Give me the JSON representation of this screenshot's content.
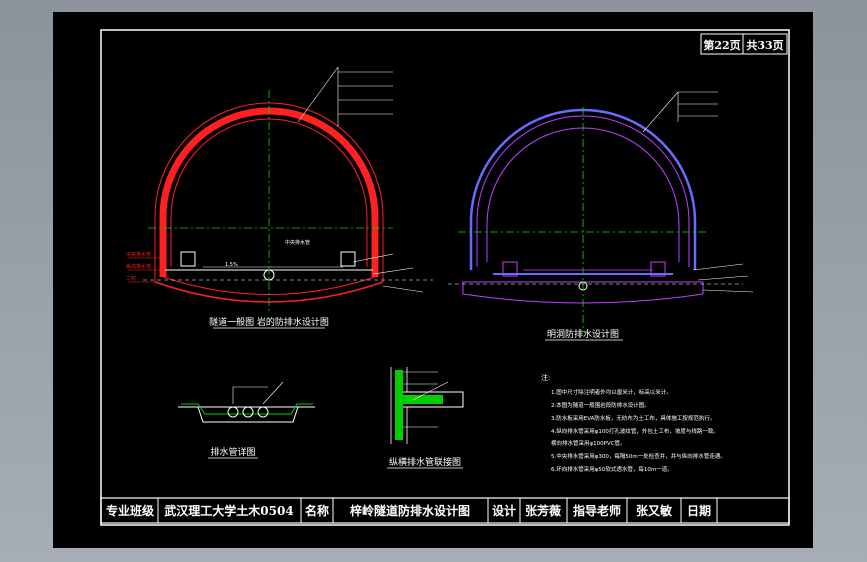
{
  "page_info": {
    "current": "第22页",
    "total": "共33页"
  },
  "title_block": {
    "major_label": "专业班级",
    "major_value": "武汉理工大学土木0504",
    "name_label": "名称",
    "name_value": "梓岭隧道防排水设计图",
    "design_label": "设计",
    "design_value": "张芳薇",
    "advisor_label": "指导老师",
    "advisor_value": "张又敏",
    "date_label": "日期"
  },
  "drawings": {
    "left_tunnel_title": "隧道一般图  岩的防排水设计图",
    "right_tunnel_title": "明洞防排水设计图",
    "drain_detail_title": "排水管详图",
    "longitudinal_title": "纵横排水管联接图"
  },
  "annotations": {
    "left_side_1": "中央排水管",
    "left_side_2": "纵向排水管",
    "left_side_3": "二衬",
    "center_text": "中央排水管",
    "left_slope": "1.5%",
    "notes_title": "注:"
  },
  "notes": [
    "1.图中尺寸除注明者外均以厘米计，标高以米计。",
    "2.本图为隧道一般围岩段防排水设计图。",
    "3.防水板采用EVA防水板，无纺布为土工布，具体施工按规范执行。",
    "4.纵向排水管采用φ100打孔波纹管，外包土工布，坡度与线路一致。",
    "  横向排水管采用φ100PVC管。",
    "5.中央排水管采用φ300，每隔50m一处检查井，并与纵向排水管连通。",
    "6.环向排水管采用φ50软式透水管，每10m一道。"
  ],
  "colors": {
    "background": "#000000",
    "frame": "#ffffff",
    "left_lining": "#ff2020",
    "right_lining": "#c040ff",
    "right_outer": "#6a6aff",
    "centerline": "#00e000",
    "detail_green": "#00d000"
  }
}
